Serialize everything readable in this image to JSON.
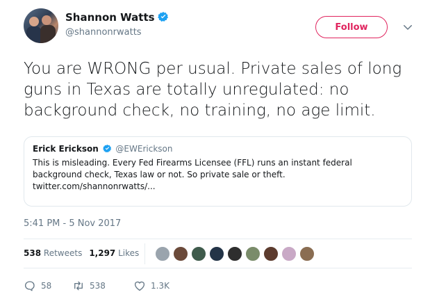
{
  "author": {
    "name": "Shannon Watts",
    "handle": "@shannonrwatts",
    "avatar_icon": "profile-photo",
    "verified_icon": "verified-badge-icon"
  },
  "header": {
    "follow_label": "Follow",
    "menu_icon": "chevron-down-icon"
  },
  "tweet": {
    "text": "You are WRONG per usual. Private sales of long guns in Texas are totally unregulated: no background check, no training, no age limit."
  },
  "quote": {
    "name": "Erick Erickson",
    "handle": "@EWErickson",
    "lines": [
      "This is misleading. Every Fed Firearms Licensee (FFL) runs an instant federal",
      "background check, Texas law or not. So private sale or theft.",
      "twitter.com/shannonrwatts/..."
    ]
  },
  "timestamp": "5:41 PM - 5 Nov 2017",
  "stats": {
    "retweets_count": "538",
    "retweets_label": "Retweets",
    "likes_count": "1,297",
    "likes_label": "Likes"
  },
  "likers": [
    {
      "color": "#9aa4ad"
    },
    {
      "color": "#6b4a3a"
    },
    {
      "color": "#3f5b4c"
    },
    {
      "color": "#233447"
    },
    {
      "color": "#2e2e2e"
    },
    {
      "color": "#7a8c6a"
    },
    {
      "color": "#5c3b2e"
    },
    {
      "color": "#c9a9c6"
    },
    {
      "color": "#8a6d52"
    }
  ],
  "actions": {
    "reply_count": "58",
    "retweet_count": "538",
    "like_count": "1.3K"
  },
  "colors": {
    "accent": "#e0245e",
    "verified": "#1da1f2",
    "muted": "#657786",
    "text": "#14171a",
    "border": "#e1e8ed"
  }
}
